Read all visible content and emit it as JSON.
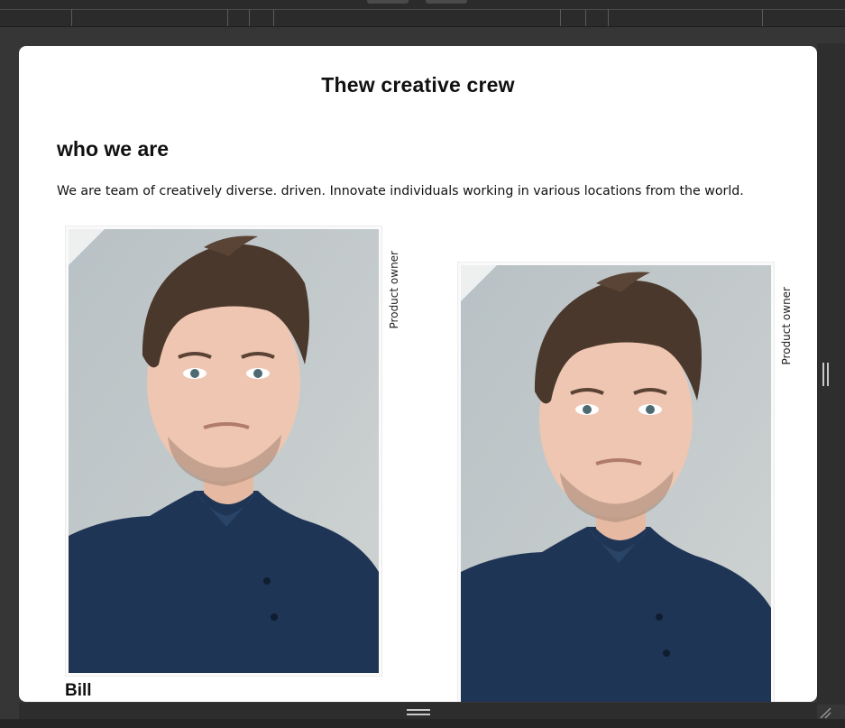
{
  "page": {
    "title": "Thew creative crew",
    "section_heading": "who we are",
    "intro": "We are team of creatively diverse. driven. Innovate individuals working in various locations from the world."
  },
  "team": [
    {
      "name": "Bill Mahoney",
      "role": "Product owner",
      "photo_icon": "person-portrait"
    },
    {
      "name": "",
      "role": "Product owner",
      "photo_icon": "person-portrait"
    }
  ],
  "colors": {
    "card_background": "#ffffff",
    "workspace_background": "#343434",
    "toolbar_background": "#2b2b2b",
    "text": "#111111",
    "photo_backdrop": "#bcc4c7",
    "shirt": "#1f3555"
  }
}
